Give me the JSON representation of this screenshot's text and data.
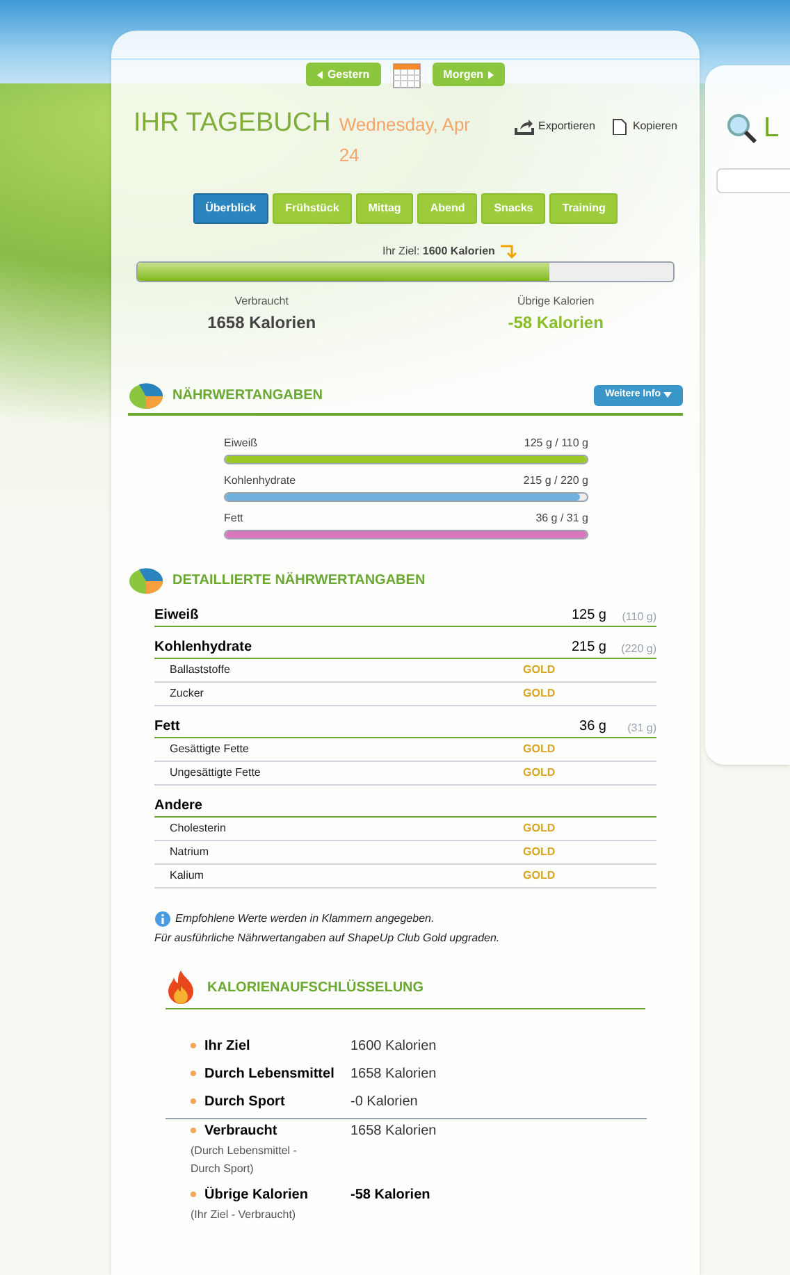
{
  "nav": {
    "prev": "Gestern",
    "next": "Morgen"
  },
  "title": "IHR TAGEBUCH",
  "date": "Wednesday, Apr 24",
  "actions": [
    "Exportieren",
    "Kopieren"
  ],
  "tabs": [
    {
      "label": "Überblick",
      "selected": true
    },
    {
      "label": "Frühstück",
      "selected": false
    },
    {
      "label": "Mittag",
      "selected": false
    },
    {
      "label": "Abend",
      "selected": false
    },
    {
      "label": "Snacks",
      "selected": false
    },
    {
      "label": "Training",
      "selected": false
    }
  ],
  "goal": {
    "label": "Ihr Ziel:",
    "value": "1600 Kalorien",
    "level": 0.77
  },
  "consumed": {
    "label": "Verbraucht",
    "value": "1658 Kalorien"
  },
  "remaining": {
    "label": "Übrige Kalorien",
    "value": "-58 Kalorien"
  },
  "nutrition": {
    "title": "NÄHRWERTANGABEN",
    "button": "Weitere Info",
    "bars": [
      {
        "name": "Eiweiß",
        "reading": "125 g / 110 g",
        "level": 1,
        "color": "#9cc927"
      },
      {
        "name": "Kohlenhydrate",
        "reading": "215 g / 220 g",
        "level": 0.98,
        "color": "#6fb0dc"
      },
      {
        "name": "Fett",
        "reading": "36 g / 31 g",
        "level": 1,
        "color": "#d977bd"
      }
    ]
  },
  "details": {
    "title": "DETAILLIERTE NÄHRWERTANGABEN",
    "groups": [
      {
        "name": "Eiweiß",
        "value": "125 g",
        "recommended": "(110 g)"
      },
      {
        "name": "Kohlenhydrate",
        "value": "215 g",
        "recommended": "(220 g)",
        "rows": [
          {
            "name": "Ballaststoffe",
            "value": "GOLD"
          },
          {
            "name": "Zucker",
            "value": "GOLD"
          }
        ]
      },
      {
        "name": "Fett",
        "value": "36 g",
        "recommended": "(31 g)",
        "rows": [
          {
            "name": "Gesättigte Fette",
            "value": "GOLD"
          },
          {
            "name": "Ungesättigte Fette",
            "value": "GOLD"
          }
        ]
      },
      {
        "name": "Andere",
        "rows": [
          {
            "name": "Cholesterin",
            "value": "GOLD"
          },
          {
            "name": "Natrium",
            "value": "GOLD"
          },
          {
            "name": "Kalium",
            "value": "GOLD"
          }
        ]
      }
    ]
  },
  "notes": [
    "Empfohlene Werte werden in Klammern angegeben.",
    "Für ausführliche Nährwertangaben auf ShapeUp Club Gold upgraden."
  ],
  "breakdown": {
    "title": "KALORIENAUFSCHLÜSSELUNG",
    "items": [
      {
        "label": "Ihr Ziel",
        "value": "1600 Kalorien",
        "emphasis": false
      },
      {
        "label": "Durch Lebensmittel",
        "value": "1658 Kalorien",
        "emphasis": false
      },
      {
        "label": "Durch Sport",
        "value": "-0 Kalorien",
        "emphasis": false
      }
    ],
    "totals": [
      {
        "label": "Verbraucht",
        "note": "(Durch Lebensmittel - Durch Sport)",
        "value": "1658 Kalorien",
        "emphasis": false
      },
      {
        "label": "Übrige Kalorien",
        "note": "(Ihr Ziel - Verbraucht)",
        "value": "-58 Kalorien",
        "emphasis": true
      }
    ]
  },
  "side": {
    "title": "L"
  }
}
